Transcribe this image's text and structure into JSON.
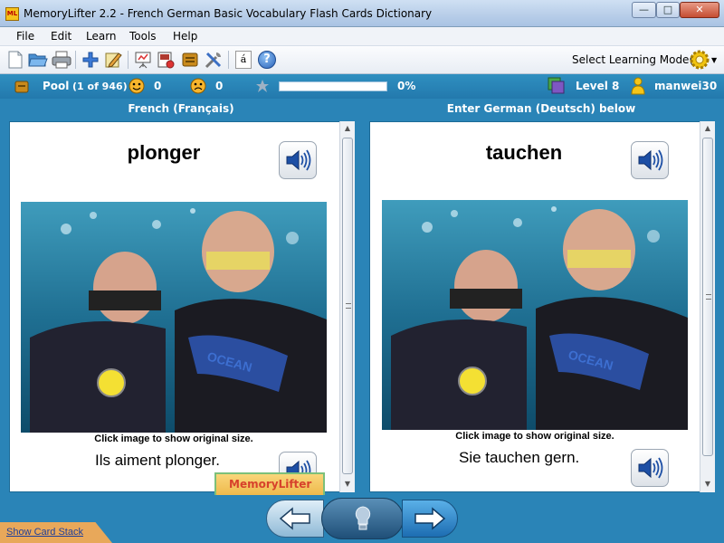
{
  "window": {
    "title": "MemoryLifter 2.2 - French German Basic Vocabulary Flash Cards Dictionary",
    "logo_text": "ML",
    "minimize": "—",
    "maximize": "□",
    "close": "✕"
  },
  "menu": {
    "items": [
      "File",
      "Edit",
      "Learn",
      "Tools",
      "Help"
    ]
  },
  "toolbar": {
    "icons": [
      "new-icon",
      "open-icon",
      "print-icon",
      "add-card-icon",
      "edit-icon",
      "presentation-icon",
      "slideshow-icon",
      "box-icon",
      "settings-tools-icon",
      "character-map-icon",
      "help-icon"
    ],
    "char_map_label": "á",
    "help_label": "?",
    "mode_label": "Select Learning Mode(s)"
  },
  "status": {
    "pool_label": "Pool",
    "pool_count": "(1 of 946)",
    "correct_count": "0",
    "wrong_count": "0",
    "progress_percent": 0,
    "progress_text": "0%",
    "level_text": "Level 8",
    "username": "manwei30"
  },
  "question": {
    "header": "French (Français)",
    "word": "plonger",
    "caption": "Click image to show original size.",
    "sentence": "Ils aiment plonger."
  },
  "answer": {
    "header": "Enter German (Deutsch) below",
    "word": "tauchen",
    "caption": "Click image to show original size.",
    "sentence": "Sie tauchen gern."
  },
  "watermark_text": "MemoryLifter",
  "footer": {
    "show_card_stack": "Show Card Stack"
  },
  "colors": {
    "accent": "#2a84b7",
    "status_bar": "#2379ad",
    "link": "#1f3f9a"
  }
}
